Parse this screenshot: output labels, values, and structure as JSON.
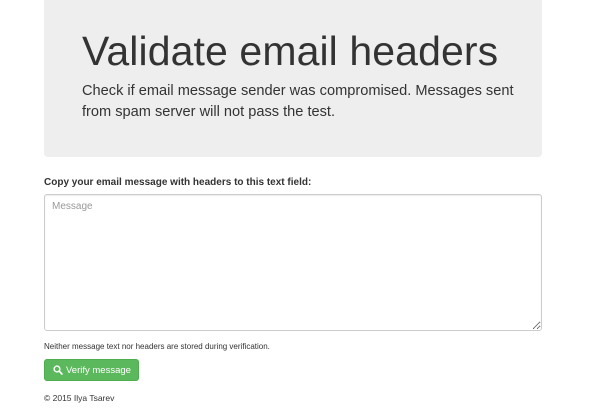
{
  "header": {
    "title": "Validate email headers",
    "description": "Check if email message sender was compromised. Messages sent from spam server will not pass the test."
  },
  "form": {
    "label": "Copy your email message with headers to this text field:",
    "message_placeholder": "Message",
    "message_value": "",
    "help_text": "Neither message text nor headers are stored during verification.",
    "submit_label": "Verify message",
    "submit_icon": "search-icon",
    "submit_color": "#5cb85c"
  },
  "footer": {
    "copyright": "© 2015 Ilya Tsarev"
  }
}
